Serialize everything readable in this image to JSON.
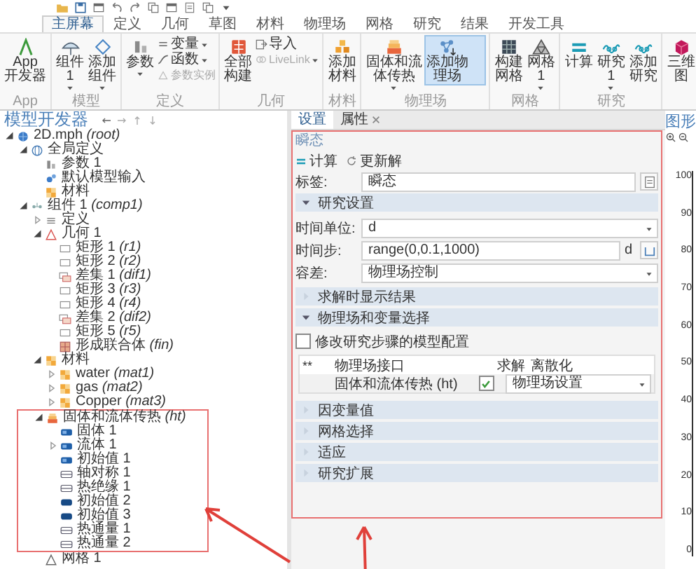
{
  "ribbon": {
    "tabs": [
      {
        "label": "主屏幕",
        "selected": true
      },
      {
        "label": "定义",
        "selected": false
      },
      {
        "label": "几何",
        "selected": false
      },
      {
        "label": "草图",
        "selected": false
      },
      {
        "label": "材料",
        "selected": false
      },
      {
        "label": "物理场",
        "selected": false
      },
      {
        "label": "网格",
        "selected": false
      },
      {
        "label": "研究",
        "selected": false
      },
      {
        "label": "结果",
        "selected": false
      },
      {
        "label": "开发工具",
        "selected": false
      }
    ],
    "groups": [
      {
        "label": "App",
        "items": [
          {
            "kind": "large",
            "label": "App\n开发器",
            "dropdown": false,
            "selected": false
          }
        ]
      },
      {
        "label": "模型",
        "items": [
          {
            "kind": "large",
            "label": "组件 1",
            "dropdown": true,
            "selected": false
          },
          {
            "kind": "large",
            "label": "添加组件",
            "dropdown": true,
            "selected": false
          }
        ]
      },
      {
        "label": "定义",
        "items": [
          {
            "kind": "large",
            "label": "参数",
            "dropdown": true,
            "selected": false
          },
          {
            "kind": "small",
            "label": "变量",
            "dropdown": true,
            "disabled": false
          },
          {
            "kind": "small",
            "label": "函数",
            "dropdown": true,
            "disabled": false
          },
          {
            "kind": "small",
            "label": "参数实例",
            "dropdown": false,
            "disabled": true
          }
        ]
      },
      {
        "label": "几何",
        "items": [
          {
            "kind": "large",
            "label": "全部构建",
            "dropdown": false,
            "selected": false
          },
          {
            "kind": "small",
            "label": "导入",
            "dropdown": false,
            "disabled": false
          },
          {
            "kind": "small",
            "label": "LiveLink",
            "dropdown": true,
            "disabled": true
          }
        ]
      },
      {
        "label": "材料",
        "items": [
          {
            "kind": "large",
            "label": "添加材料",
            "dropdown": false,
            "selected": false
          }
        ]
      },
      {
        "label": "物理场",
        "items": [
          {
            "kind": "large",
            "label": "固体和流体传热",
            "dropdown": true,
            "selected": false
          },
          {
            "kind": "large",
            "label": "添加物理场",
            "dropdown": false,
            "selected": true
          }
        ]
      },
      {
        "label": "网格",
        "items": [
          {
            "kind": "large",
            "label": "构建网格",
            "dropdown": false,
            "selected": false
          },
          {
            "kind": "large",
            "label": "网格 1",
            "dropdown": true,
            "selected": false
          }
        ]
      },
      {
        "label": "研究",
        "items": [
          {
            "kind": "large",
            "label": "计算",
            "dropdown": false,
            "selected": false
          },
          {
            "kind": "large",
            "label": "研究 1",
            "dropdown": true,
            "selected": false
          },
          {
            "kind": "large",
            "label": "添加研究",
            "dropdown": false,
            "selected": false
          }
        ]
      },
      {
        "items": [
          {
            "kind": "large",
            "label": "三维图",
            "dropdown": false,
            "selected": false
          }
        ]
      }
    ]
  },
  "model_builder": {
    "title": "模型开发器",
    "tree": [
      {
        "label": "2D.mph *(root)*",
        "kind": "file",
        "expanded": true,
        "children": [
          {
            "label": "全局定义",
            "kind": "globe",
            "expanded": true,
            "children": [
              {
                "label": "参数 1",
                "kind": "param"
              },
              {
                "label": "默认模型输入",
                "kind": "input"
              },
              {
                "label": "材料",
                "kind": "material"
              }
            ]
          },
          {
            "label": "组件 1 *(comp1)*",
            "kind": "component",
            "expanded": true,
            "children": [
              {
                "label": "定义",
                "kind": "definitions",
                "expanded": false,
                "annotated": false
              },
              {
                "label": "几何 1",
                "kind": "geometry",
                "expanded": true,
                "annotated": false,
                "children": [
                  {
                    "label": "矩形 1 *(r1)*",
                    "kind": "rect"
                  },
                  {
                    "label": "矩形 2 *(r2)*",
                    "kind": "rect"
                  },
                  {
                    "label": "差集 1 *(dif1)*",
                    "kind": "difference"
                  },
                  {
                    "label": "矩形 3 *(r3)*",
                    "kind": "rect"
                  },
                  {
                    "label": "矩形 4 *(r4)*",
                    "kind": "rect"
                  },
                  {
                    "label": "差集 2 *(dif2)*",
                    "kind": "difference"
                  },
                  {
                    "label": "矩形 5 *(r5)*",
                    "kind": "rect"
                  },
                  {
                    "label": "形成联合体 *(fin)*",
                    "kind": "union"
                  }
                ]
              },
              {
                "label": "材料",
                "kind": "material",
                "expanded": true,
                "annotated": false,
                "children": [
                  {
                    "label": "water *(mat1)*",
                    "kind": "material",
                    "expanded": false
                  },
                  {
                    "label": "gas *(mat2)*",
                    "kind": "material",
                    "expanded": false
                  },
                  {
                    "label": "Copper *(mat3)*",
                    "kind": "material",
                    "expanded": false
                  }
                ]
              },
              {
                "label": "固体和流体传热 *(ht)*",
                "kind": "physics",
                "expanded": true,
                "annotated": true,
                "children": [
                  {
                    "label": "固体 1",
                    "kind": "domain"
                  },
                  {
                    "label": "流体 1",
                    "kind": "domain",
                    "expanded": false
                  },
                  {
                    "label": "初始值 1",
                    "kind": "domain"
                  },
                  {
                    "label": "轴对称 1",
                    "kind": "boundary"
                  },
                  {
                    "label": "热绝缘 1",
                    "kind": "boundary"
                  },
                  {
                    "label": "初始值 2",
                    "kind": "point"
                  },
                  {
                    "label": "初始值 3",
                    "kind": "point"
                  },
                  {
                    "label": "热通量 1",
                    "kind": "boundary"
                  },
                  {
                    "label": "热通量 2",
                    "kind": "boundary"
                  }
                ]
              },
              {
                "label": "网格 1",
                "kind": "mesh",
                "annotated": false
              }
            ]
          }
        ]
      }
    ]
  },
  "settings": {
    "tabs": [
      {
        "label": "设置",
        "selected": true,
        "closable": false
      },
      {
        "label": "属性",
        "selected": false,
        "closable": true
      }
    ],
    "annotated": true,
    "heading": "瞬态",
    "actions": [
      {
        "label": "计算",
        "kind": "compute"
      },
      {
        "label": "更新解",
        "kind": "refresh"
      }
    ],
    "label_field": {
      "label": "标签:",
      "value": "瞬态"
    },
    "sections": [
      {
        "title": "研究设置",
        "expanded": true,
        "fields": [
          {
            "kind": "select",
            "label": "时间单位:",
            "value": "d"
          },
          {
            "kind": "text",
            "label": "时间步:",
            "value": "range(0,0.1,1000)",
            "unit": "d"
          },
          {
            "kind": "select",
            "label": "容差:",
            "value": "物理场控制"
          }
        ]
      },
      {
        "title": "求解时显示结果",
        "expanded": false
      },
      {
        "title": "物理场和变量选择",
        "expanded": true,
        "checkbox": {
          "label": "修改研究步骤的模型配置",
          "checked": false
        },
        "table": {
          "marker": "**",
          "columns": [
            "物理场接口",
            "求解",
            "离散化"
          ],
          "rows": [
            {
              "interface": "固体和流体传热 (ht)",
              "solve": true,
              "discretization": "物理场设置"
            }
          ]
        }
      },
      {
        "title": "因变量值",
        "expanded": false
      },
      {
        "title": "网格选择",
        "expanded": false
      },
      {
        "title": "适应",
        "expanded": false
      },
      {
        "title": "研究扩展",
        "expanded": false
      }
    ]
  },
  "graphics": {
    "title": "图形",
    "axis_ticks": [
      "100",
      "90",
      "80",
      "70",
      "60",
      "50",
      "40",
      "30",
      "20",
      "10",
      "0"
    ]
  }
}
